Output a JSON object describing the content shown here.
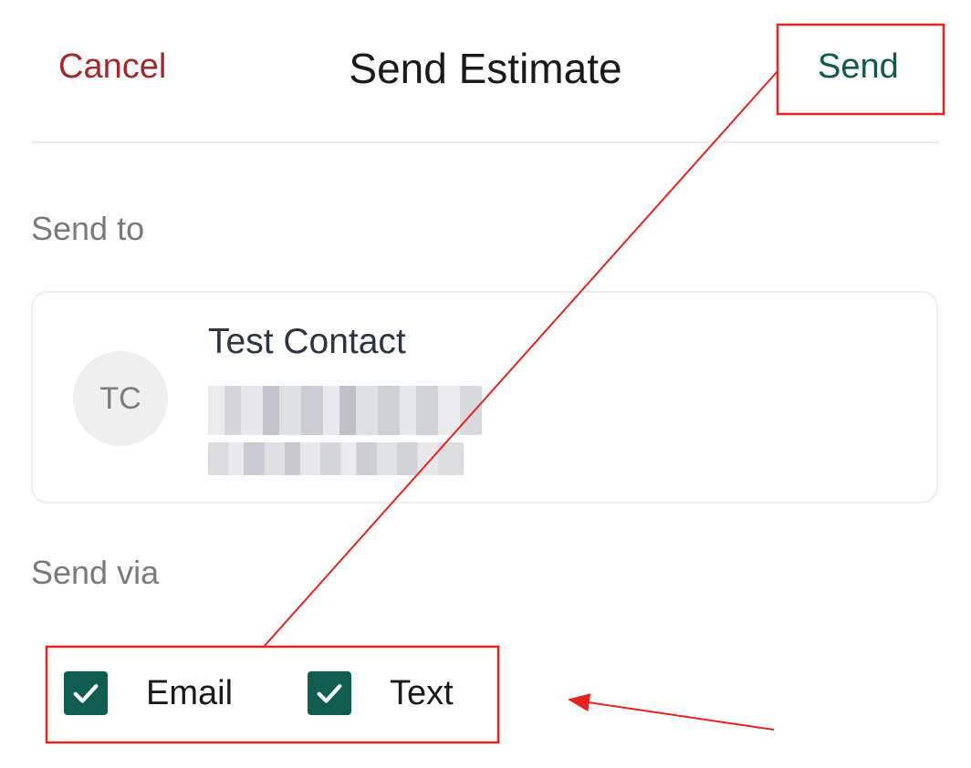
{
  "header": {
    "cancel_label": "Cancel",
    "title": "Send Estimate",
    "send_label": "Send"
  },
  "send_to": {
    "label": "Send to",
    "contact": {
      "initials": "TC",
      "name": "Test Contact"
    }
  },
  "send_via": {
    "label": "Send via",
    "options": [
      {
        "label": "Email",
        "checked": true
      },
      {
        "label": "Text",
        "checked": true
      }
    ]
  },
  "colors": {
    "accent": "#0f5e50",
    "cancel": "#a32a2a",
    "annotation": "#e8231f"
  },
  "icons": {
    "checkbox_checked": "check-icon"
  }
}
